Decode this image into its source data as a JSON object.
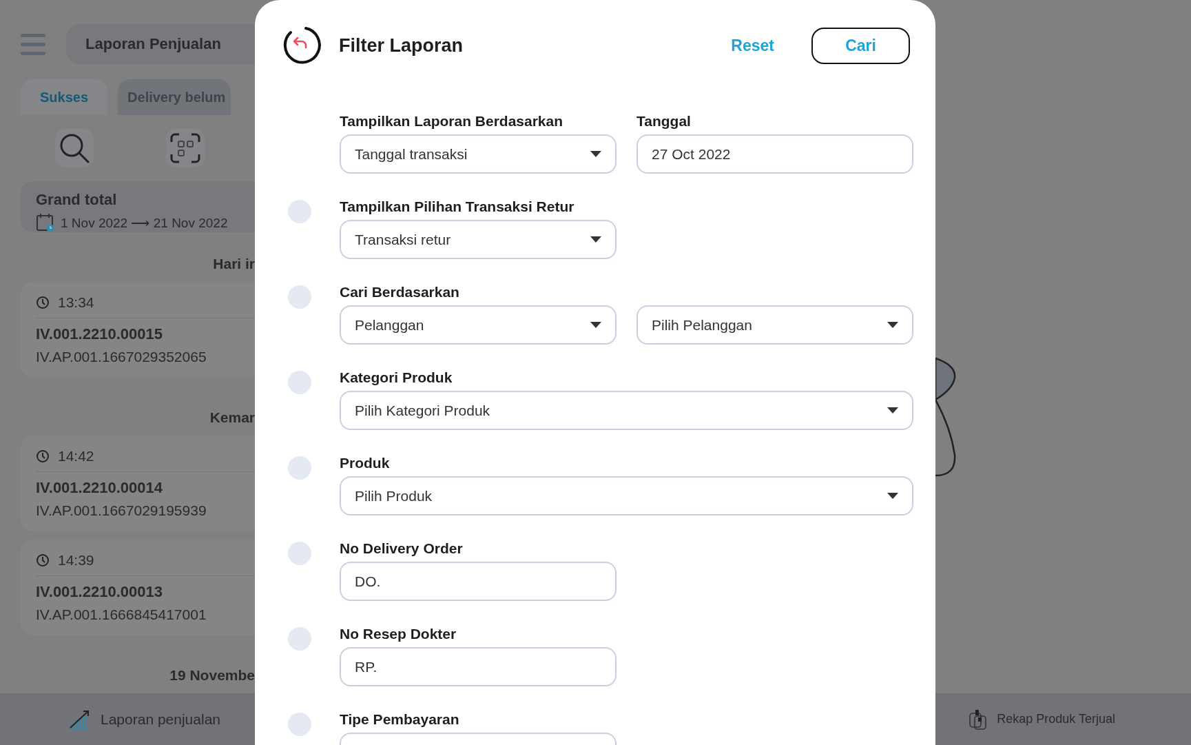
{
  "app_bar": {
    "title": "Laporan Penjualan"
  },
  "tabs": [
    {
      "label": "Sukses",
      "selected": true
    },
    {
      "label": "Delivery belum",
      "selected": false
    }
  ],
  "grand_total": {
    "title": "Grand total",
    "date_range": "1 Nov 2022 ⟶ 21 Nov 2022"
  },
  "transaction_groups": [
    {
      "heading": "Hari ir",
      "transactions": [
        {
          "time": "13:34",
          "invoice": "IV.001.2210.00015",
          "reference": "IV.AP.001.1667029352065"
        }
      ]
    },
    {
      "heading": "Kemar",
      "transactions": [
        {
          "time": "14:42",
          "invoice": "IV.001.2210.00014",
          "reference": "IV.AP.001.1667029195939"
        },
        {
          "time": "14:39",
          "invoice": "IV.001.2210.00013",
          "reference": "IV.AP.001.1666845417001"
        }
      ]
    },
    {
      "heading": "19 Novembe"
    }
  ],
  "bottom_nav": [
    {
      "kind": "chart",
      "label": "Laporan penjualan"
    },
    {
      "kind": "recap",
      "label": "Rekap Produk Terjual"
    }
  ],
  "filter_dialog": {
    "title": "Filter Laporan",
    "reset_label": "Reset",
    "search_label": "Cari",
    "rows": [
      {
        "kind": "fixed",
        "fields": [
          {
            "label": "Tampilkan Laporan Berdasarkan",
            "kind": "dropdown",
            "value": "Tanggal transaksi"
          },
          {
            "label": "Tanggal",
            "kind": "text",
            "value": "27 Oct 2022"
          }
        ]
      },
      {
        "kind": "optional",
        "checked": false,
        "fields": [
          {
            "label": "Tampilkan Pilihan Transaksi Retur",
            "kind": "dropdown",
            "value": "Transaksi retur"
          }
        ]
      },
      {
        "kind": "optional",
        "checked": false,
        "fields": [
          {
            "label": "Cari Berdasarkan",
            "kind": "dropdown",
            "value": "Pelanggan"
          },
          {
            "kind": "dropdown",
            "value": "Pilih Pelanggan"
          }
        ]
      },
      {
        "kind": "optional",
        "checked": false,
        "fields": [
          {
            "label": "Kategori Produk",
            "kind": "dropdown_wide",
            "value": "Pilih Kategori Produk"
          }
        ]
      },
      {
        "kind": "optional",
        "checked": false,
        "fields": [
          {
            "label": "Produk",
            "kind": "dropdown_wide",
            "value": "Pilih Produk"
          }
        ]
      },
      {
        "kind": "optional",
        "checked": false,
        "fields": [
          {
            "label": "No Delivery Order",
            "kind": "text",
            "value": "DO."
          }
        ]
      },
      {
        "kind": "optional",
        "checked": false,
        "fields": [
          {
            "label": "No Resep Dokter",
            "kind": "text",
            "value": "RP."
          }
        ]
      },
      {
        "kind": "optional",
        "checked": false,
        "fields": [
          {
            "label": "Tipe Pembayaran",
            "kind": "text"
          }
        ]
      }
    ]
  }
}
